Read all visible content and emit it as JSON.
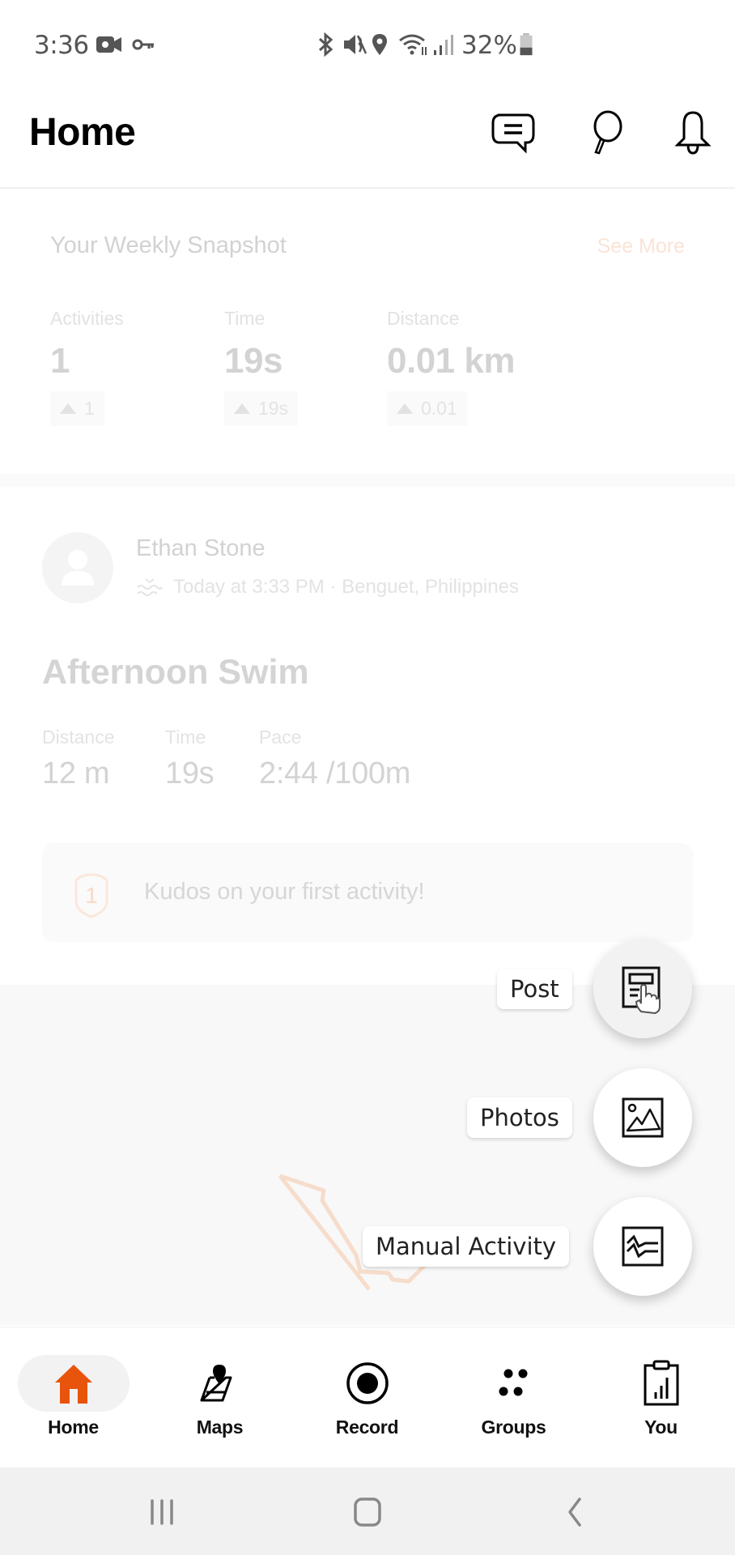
{
  "status_bar": {
    "time": "3:36",
    "left_icons": [
      "video-camera-icon",
      "vpn-key-icon"
    ],
    "right_icons": [
      "bluetooth-icon",
      "mute-icon",
      "location-icon",
      "wifi-icon",
      "signal-icon",
      "battery-icon"
    ],
    "battery": "32%"
  },
  "header": {
    "title": "Home",
    "icons": [
      "chat-icon",
      "search-icon",
      "bell-icon"
    ]
  },
  "snapshot": {
    "title": "Your Weekly Snapshot",
    "see_more": "See More",
    "stats": [
      {
        "label": "Activities",
        "value": "1",
        "delta": "1"
      },
      {
        "label": "Time",
        "value": "19s",
        "delta": "19s"
      },
      {
        "label": "Distance",
        "value": "0.01 km",
        "delta": "0.01"
      }
    ]
  },
  "activity": {
    "athlete": "Ethan Stone",
    "meta": "Today at 3:33 PM · Benguet, Philippines",
    "sport_icon": "swim-icon",
    "title": "Afternoon Swim",
    "stats": [
      {
        "label": "Distance",
        "value": "12 m"
      },
      {
        "label": "Time",
        "value": "19s"
      },
      {
        "label": "Pace",
        "value": "2:44 /100m"
      }
    ],
    "kudos_badge": "1",
    "kudos_text": "Kudos on your first activity!"
  },
  "speed_dial": [
    {
      "label": "Post",
      "icon": "post-icon"
    },
    {
      "label": "Photos",
      "icon": "photo-icon"
    },
    {
      "label": "Manual Activity",
      "icon": "activity-chart-icon"
    }
  ],
  "bottom_nav": {
    "items": [
      {
        "label": "Home",
        "icon": "home-icon",
        "active": true
      },
      {
        "label": "Maps",
        "icon": "map-icon",
        "active": false
      },
      {
        "label": "Record",
        "icon": "record-icon",
        "active": false
      },
      {
        "label": "Groups",
        "icon": "groups-icon",
        "active": false
      },
      {
        "label": "You",
        "icon": "profile-stats-icon",
        "active": false
      }
    ],
    "active_color": "#e8540c"
  },
  "system_nav": [
    "recents-button",
    "home-button",
    "back-button"
  ]
}
